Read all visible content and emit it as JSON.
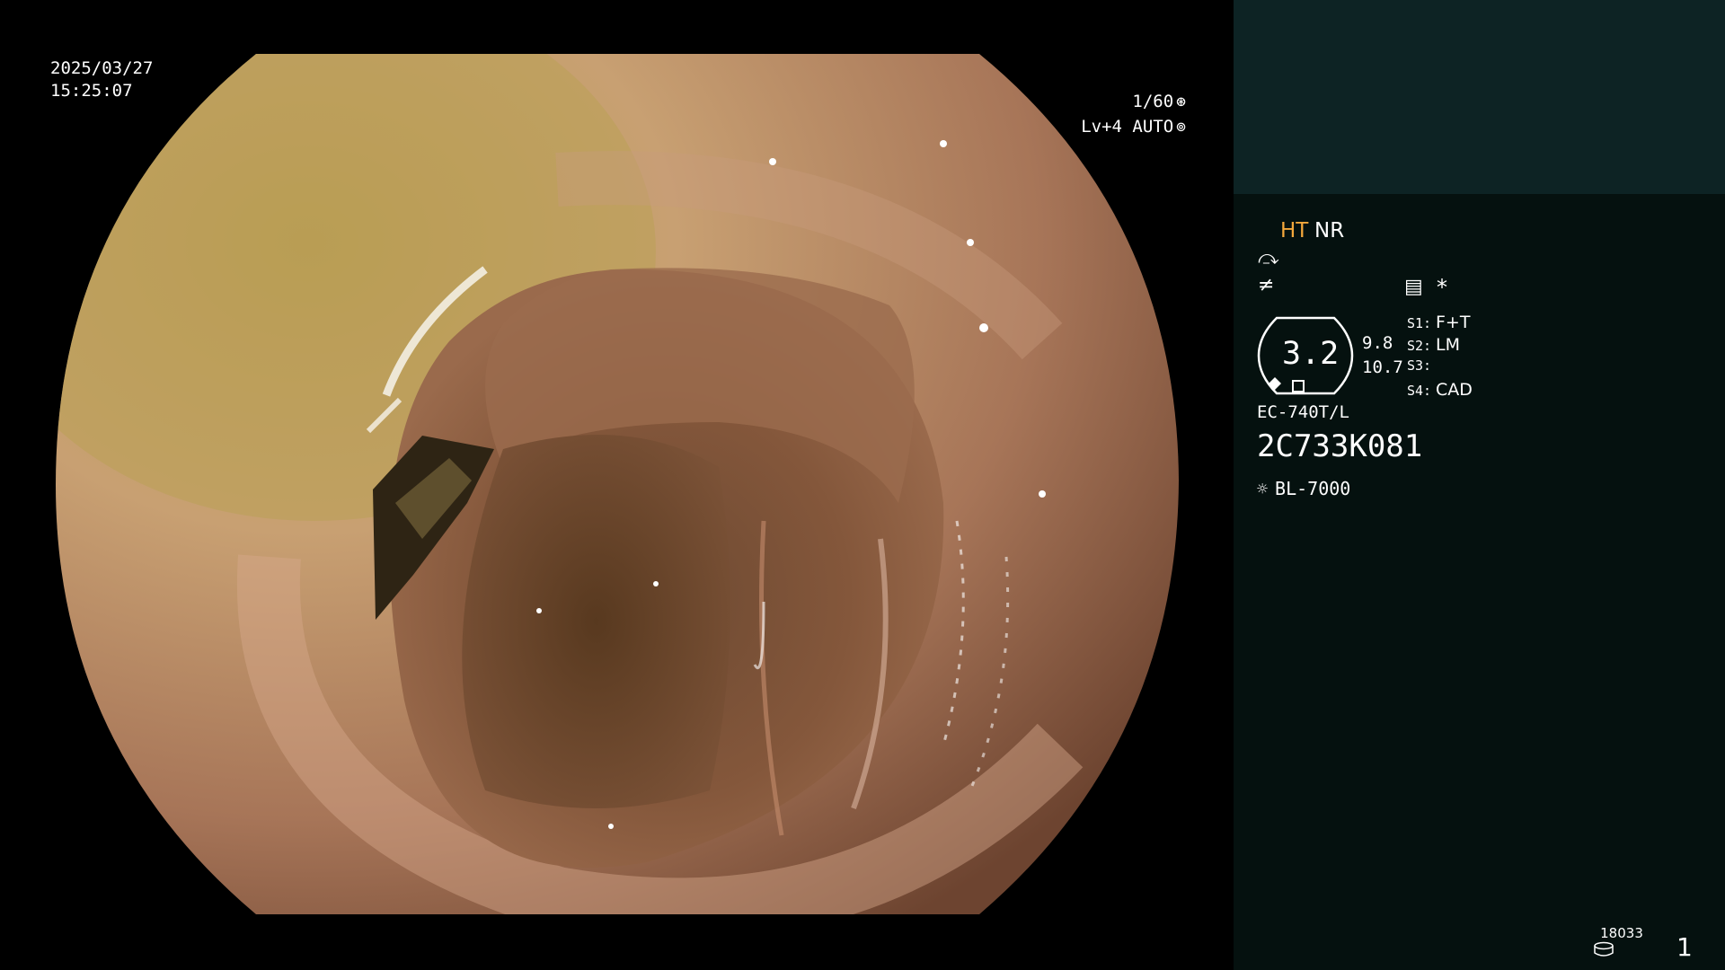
{
  "overlay": {
    "date": "2025/03/27",
    "time": "15:25:07",
    "shutter": "1/60",
    "shutter_icon": "aperture-icon",
    "level_mode": "Lv+4 AUTO",
    "level_icon": "iris-icon"
  },
  "panel": {
    "mode_ht": "HT",
    "mode_nr": "NR",
    "icons": [
      "curve-icon",
      "not-equal-icon",
      "memo-icon",
      "asterisk-icon"
    ],
    "lens_value": "3.2",
    "value_1": "9.8",
    "value_2": "10.7",
    "slots": [
      {
        "key": "S1:",
        "value": "F+T"
      },
      {
        "key": "S2:",
        "value": "LM"
      },
      {
        "key": "S3:",
        "value": ""
      },
      {
        "key": "S4:",
        "value": "CAD"
      }
    ],
    "scope_model": "EC-740T/L",
    "scope_serial": "2C733K081",
    "light_source": "BL-7000",
    "light_icon": "sun-icon",
    "counter": "18033",
    "storage_icon": "storage-icon",
    "page_number": "1"
  },
  "colors": {
    "panel_bg": "#05110f",
    "panel_top_bg": "#0d2324",
    "ht_color": "#f4a83c"
  }
}
